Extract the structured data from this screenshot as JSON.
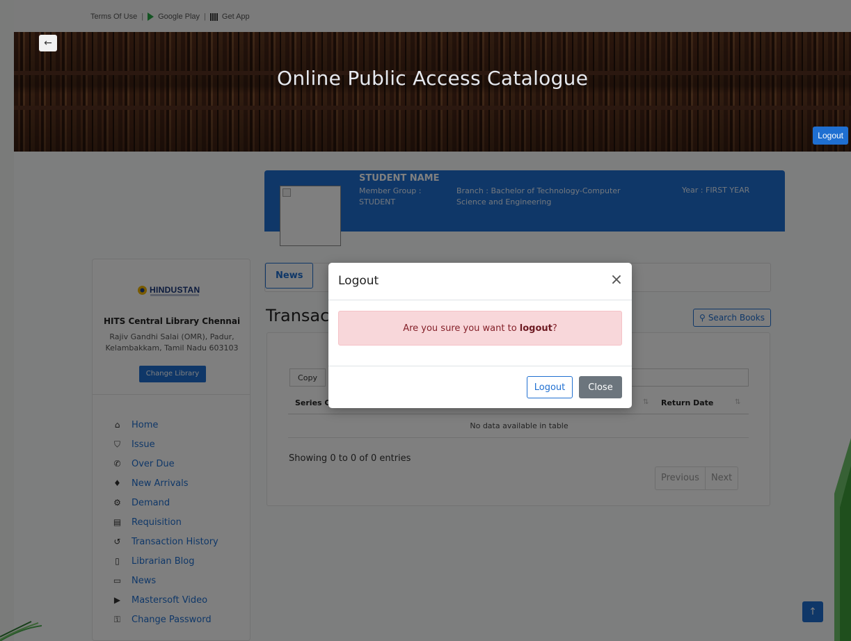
{
  "colors": {
    "primary": "#1f6fd1",
    "alert_bg": "#f8d7da",
    "alert_text": "#842029",
    "close_btn": "#6c757d",
    "overlay": "rgba(0,0,0,0.5)"
  },
  "topbar": {
    "terms": "Terms Of Use",
    "sep": "|",
    "google_play": "Google Play",
    "get_app": "Get App"
  },
  "banner": {
    "back_icon": "←",
    "title": "Online Public Access Catalogue",
    "logout_label": "Logout"
  },
  "profile": {
    "student_name": "STUDENT NAME",
    "member_group": "Member Group : STUDENT",
    "branch": "Branch : Bachelor of Technology-Computer Science and Engineering",
    "year": "Year : FIRST YEAR"
  },
  "sidebar": {
    "logo_text": "HINDUSTAN",
    "library_name": "HITS Central Library Chennai",
    "library_address": "Rajiv Gandhi Salai (OMR), Padur, Kelambakkam, Tamil Nadu 603103",
    "change_library": "Change Library",
    "items": [
      {
        "label": "Home",
        "icon": "home-icon",
        "glyph": "⌂"
      },
      {
        "label": "Issue",
        "icon": "shield-icon",
        "glyph": "⛉"
      },
      {
        "label": "Over Due",
        "icon": "phone-icon",
        "glyph": "✆"
      },
      {
        "label": "New Arrivals",
        "icon": "diamond-icon",
        "glyph": "♦"
      },
      {
        "label": "Demand",
        "icon": "settings-icon",
        "glyph": "⚙"
      },
      {
        "label": "Requisition",
        "icon": "card-icon",
        "glyph": "▤"
      },
      {
        "label": "Transaction History",
        "icon": "history-icon",
        "glyph": "↺"
      },
      {
        "label": "Librarian Blog",
        "icon": "book-icon",
        "glyph": "▯"
      },
      {
        "label": "News",
        "icon": "document-icon",
        "glyph": "▭"
      },
      {
        "label": "Mastersoft Video",
        "icon": "video-icon",
        "glyph": "▶"
      },
      {
        "label": "Change Password",
        "icon": "key-icon",
        "glyph": "⚿"
      }
    ]
  },
  "main": {
    "tab_news": "News",
    "page_title": "Transac",
    "search_books": "Search Books",
    "search_icon": "⚲",
    "copy_label": "Copy",
    "col_series": "Series C",
    "col_return": "Return Date",
    "sort_icon": "⇅",
    "empty_message": "No data available in table",
    "showing": "Showing 0 to 0 of 0 entries",
    "previous": "Previous",
    "next": "Next",
    "scroll_top_icon": "↑"
  },
  "modal": {
    "title": "Logout",
    "close_icon": "×",
    "message_prefix": "Are you sure you want to ",
    "message_bold": "logout",
    "message_suffix": "?",
    "logout_button": "Logout",
    "close_button": "Close"
  }
}
